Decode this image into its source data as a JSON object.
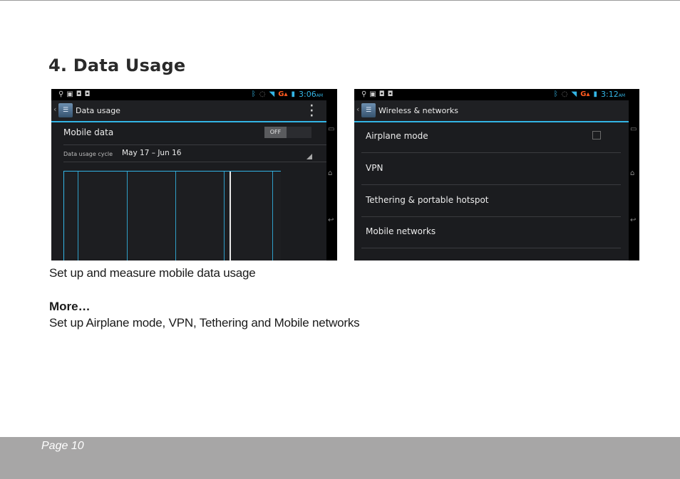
{
  "heading": "4. Data Usage",
  "screen1": {
    "status_time": "3:06",
    "status_ampm": "AM",
    "status_network": "G",
    "title": "Data usage",
    "mobile_data_label": "Mobile data",
    "mobile_data_toggle": "OFF",
    "cycle_label": "Data usage cycle",
    "cycle_value": "May 17 – Jun 16"
  },
  "screen2": {
    "status_time": "3:12",
    "status_ampm": "AM",
    "status_network": "G",
    "title": "Wireless & networks",
    "items": [
      {
        "label": "Airplane mode"
      },
      {
        "label": "VPN"
      },
      {
        "label": "Tethering & portable hotspot"
      },
      {
        "label": "Mobile networks"
      }
    ]
  },
  "caption": "Set up and measure mobile data usage",
  "more": {
    "title": "More…",
    "description": "Set up Airplane mode, VPN, Tethering and Mobile networks"
  },
  "footer": {
    "page": "Page 10"
  },
  "colors": {
    "accent": "#33b5e5",
    "signal": "#ff5a1f",
    "footer_bg": "#a7a6a6"
  }
}
